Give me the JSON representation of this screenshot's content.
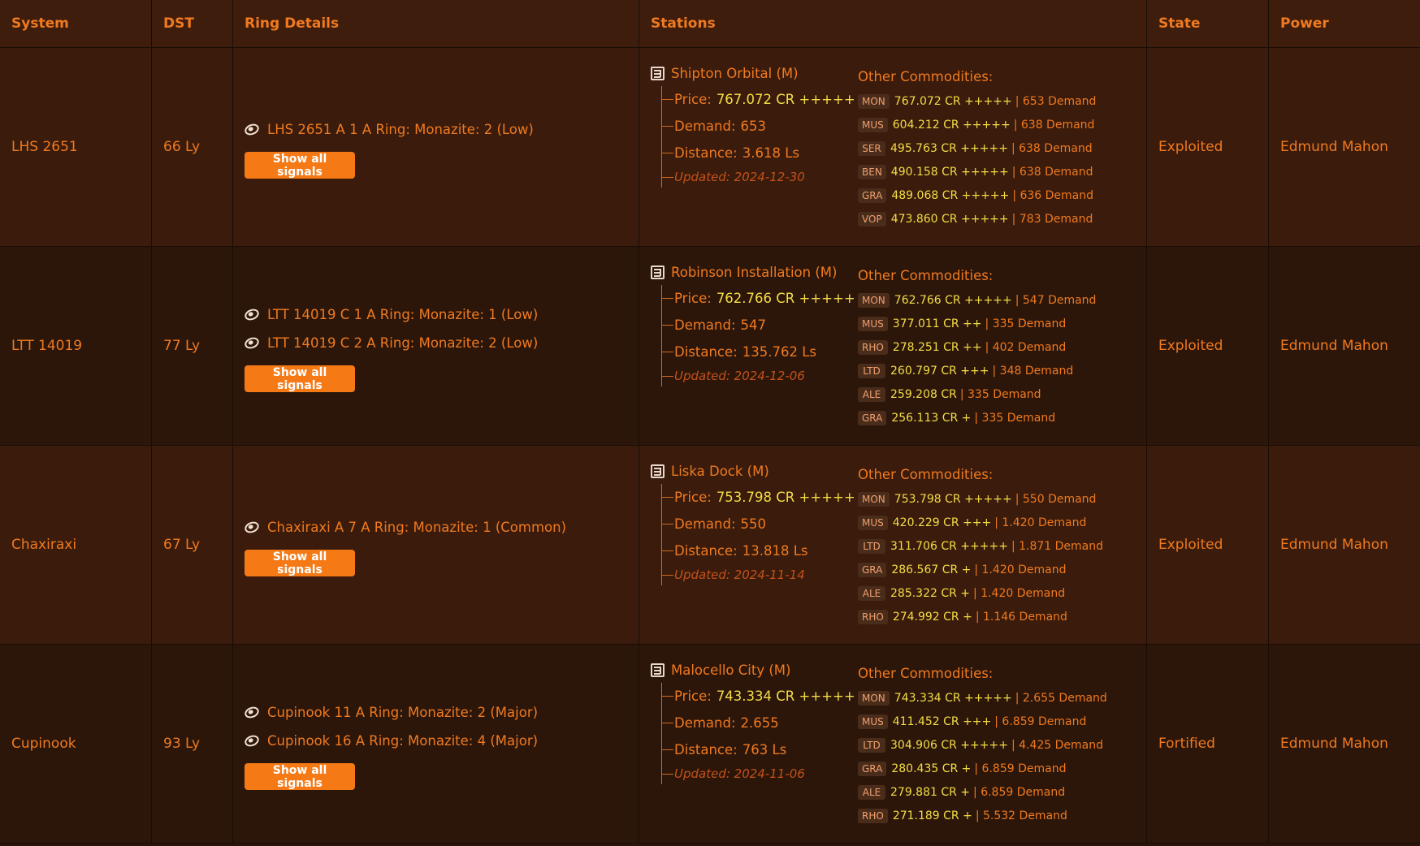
{
  "headers": {
    "system": "System",
    "dst": "DST",
    "ring": "Ring Details",
    "stations": "Stations",
    "state": "State",
    "power": "Power"
  },
  "labels": {
    "price": "Price:",
    "demand": "Demand:",
    "distance": "Distance:",
    "other": "Other Commodities:",
    "show_signals": "Show all signals"
  },
  "icons": {
    "ring": "ring-planet-icon",
    "station": "station-icon"
  },
  "rows": [
    {
      "system": "LHS 2651",
      "dst": "66 Ly",
      "rings": [
        "LHS 2651 A 1 A Ring: Monazite: 2 (Low)"
      ],
      "station": {
        "name": "Shipton Orbital (M)",
        "price": "767.072 CR +++++",
        "demand": "653",
        "distance": "3.618 Ls",
        "updated": "Updated: 2024-12-30"
      },
      "commodities": [
        {
          "tag": "MON",
          "val": "767.072 CR +++++",
          "rest": "| 653 Demand"
        },
        {
          "tag": "MUS",
          "val": "604.212 CR +++++",
          "rest": "| 638 Demand"
        },
        {
          "tag": "SER",
          "val": "495.763 CR +++++",
          "rest": "| 638 Demand"
        },
        {
          "tag": "BEN",
          "val": "490.158 CR +++++",
          "rest": "| 638 Demand"
        },
        {
          "tag": "GRA",
          "val": "489.068 CR +++++",
          "rest": "| 636 Demand"
        },
        {
          "tag": "VOP",
          "val": "473.860 CR +++++",
          "rest": "| 783 Demand"
        }
      ],
      "state": "Exploited",
      "power": "Edmund Mahon"
    },
    {
      "system": "LTT 14019",
      "dst": "77 Ly",
      "rings": [
        "LTT 14019 C 1 A Ring: Monazite: 1 (Low)",
        "LTT 14019 C 2 A Ring: Monazite: 2 (Low)"
      ],
      "station": {
        "name": "Robinson Installation (M)",
        "price": "762.766 CR +++++",
        "demand": "547",
        "distance": "135.762 Ls",
        "updated": "Updated: 2024-12-06"
      },
      "commodities": [
        {
          "tag": "MON",
          "val": "762.766 CR +++++",
          "rest": "| 547 Demand"
        },
        {
          "tag": "MUS",
          "val": "377.011 CR ++",
          "rest": "| 335 Demand"
        },
        {
          "tag": "RHO",
          "val": "278.251 CR ++",
          "rest": "| 402 Demand"
        },
        {
          "tag": "LTD",
          "val": "260.797 CR +++",
          "rest": "| 348 Demand"
        },
        {
          "tag": "ALE",
          "val": "259.208 CR",
          "rest": "| 335 Demand"
        },
        {
          "tag": "GRA",
          "val": "256.113 CR +",
          "rest": "| 335 Demand"
        }
      ],
      "state": "Exploited",
      "power": "Edmund Mahon"
    },
    {
      "system": "Chaxiraxi",
      "dst": "67 Ly",
      "rings": [
        "Chaxiraxi A 7 A Ring: Monazite: 1 (Common)"
      ],
      "station": {
        "name": "Liska Dock (M)",
        "price": "753.798 CR +++++",
        "demand": "550",
        "distance": "13.818 Ls",
        "updated": "Updated: 2024-11-14"
      },
      "commodities": [
        {
          "tag": "MON",
          "val": "753.798 CR +++++",
          "rest": "| 550 Demand"
        },
        {
          "tag": "MUS",
          "val": "420.229 CR +++",
          "rest": "| 1.420 Demand"
        },
        {
          "tag": "LTD",
          "val": "311.706 CR +++++",
          "rest": "| 1.871 Demand"
        },
        {
          "tag": "GRA",
          "val": "286.567 CR +",
          "rest": "| 1.420 Demand"
        },
        {
          "tag": "ALE",
          "val": "285.322 CR +",
          "rest": "| 1.420 Demand"
        },
        {
          "tag": "RHO",
          "val": "274.992 CR +",
          "rest": "| 1.146 Demand"
        }
      ],
      "state": "Exploited",
      "power": "Edmund Mahon"
    },
    {
      "system": "Cupinook",
      "dst": "93 Ly",
      "rings": [
        "Cupinook 11 A Ring: Monazite: 2 (Major)",
        "Cupinook 16 A Ring: Monazite: 4 (Major)"
      ],
      "station": {
        "name": "Malocello City (M)",
        "price": "743.334 CR +++++",
        "demand": "2.655",
        "distance": "763 Ls",
        "updated": "Updated: 2024-11-06"
      },
      "commodities": [
        {
          "tag": "MON",
          "val": "743.334 CR +++++",
          "rest": "| 2.655 Demand"
        },
        {
          "tag": "MUS",
          "val": "411.452 CR +++",
          "rest": "| 6.859 Demand"
        },
        {
          "tag": "LTD",
          "val": "304.906 CR +++++",
          "rest": "| 4.425 Demand"
        },
        {
          "tag": "GRA",
          "val": "280.435 CR +",
          "rest": "| 6.859 Demand"
        },
        {
          "tag": "ALE",
          "val": "279.881 CR +",
          "rest": "| 6.859 Demand"
        },
        {
          "tag": "RHO",
          "val": "271.189 CR +",
          "rest": "| 5.532 Demand"
        }
      ],
      "state": "Fortified",
      "power": "Edmund Mahon"
    }
  ]
}
